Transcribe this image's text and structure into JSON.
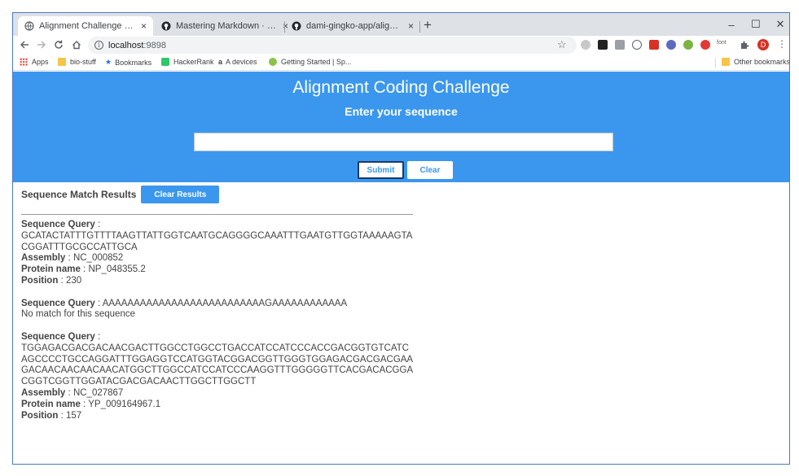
{
  "browser": {
    "tabs": [
      {
        "title": "Alignment Challenge by Dami",
        "active": true
      },
      {
        "title": "Mastering Markdown · GitHub G",
        "active": false
      },
      {
        "title": "dami-gingko-app/alignment",
        "active": false
      }
    ],
    "close_glyph": "×",
    "new_tab_glyph": "+",
    "window_controls": {
      "minimize": "–",
      "maximize": "☐",
      "close": "✕"
    },
    "url_host": "localhost",
    "url_port": ":9898",
    "profile_initial": "D",
    "ext_font_label": "font",
    "bookmarks": [
      "Apps",
      "bio-stuff",
      "Bookmarks",
      "HackerRank",
      "A devices",
      "Getting Started | Sp...",
      "Other bookmarks"
    ]
  },
  "page": {
    "title": "Alignment Coding Challenge",
    "subtitle": "Enter your sequence",
    "input_value": "",
    "submit_label": "Submit",
    "clear_label": "Clear",
    "results_title": "Sequence Match Results",
    "clear_results_label": "Clear Results"
  },
  "labels": {
    "query": "Sequence Query",
    "assembly": "Assembly",
    "protein": "Protein name",
    "position": "Position",
    "sep": " : "
  },
  "results": [
    {
      "query": "GCATACTATTTGTTTTAAGTTATTGGTCAATGCAGGGGCAAATTTGAATGTTGGTAAAAAGTACGGATTTGCGCCATTGCA",
      "assembly": "NC_000852",
      "protein": "NP_048355.2",
      "position": "230"
    },
    {
      "query": "AAAAAAAAAAAAAAAAAAAAAAAAAAGAAAAAAAAAAAA",
      "no_match": "No match for this sequence"
    },
    {
      "query": "TGGAGACGACGACAACGACTTGGCCTGGCCTGACCATCCATCCCACCGACGGTGTCATCAGCCCCTGCCAGGATTTGGAGGTCCATGGTACGGACGGTTGGGTGGAGACGACGACGAAGACAACAACAACAACATGGCTTGGCCATCCATCCCAAGGTTTGGGGGTTCACGACACGGACGGTCGGTTGGATACGACGACAACTTGGCTTGGCTT",
      "assembly": "NC_027867",
      "protein": "YP_009164967.1",
      "position": "157"
    }
  ]
}
